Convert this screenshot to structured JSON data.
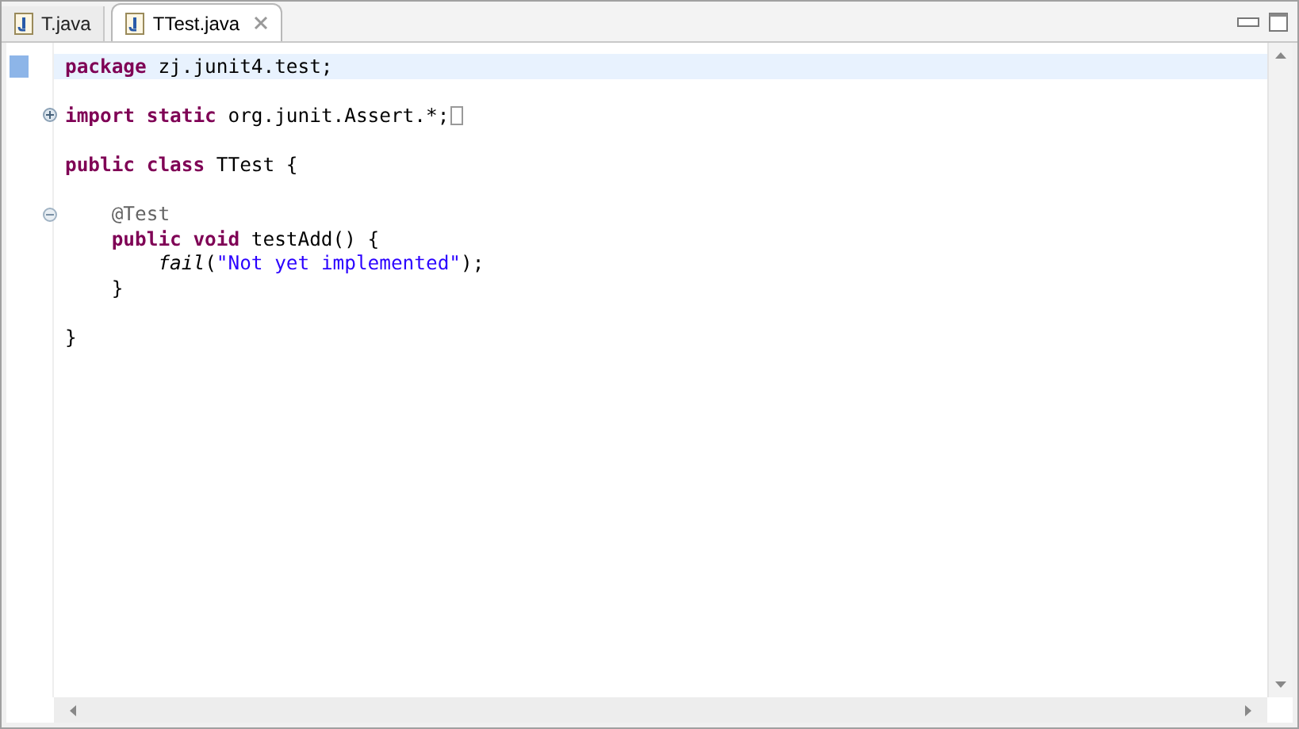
{
  "tabs": [
    {
      "label": "T.java",
      "selected": false
    },
    {
      "label": "TTest.java",
      "selected": true
    }
  ],
  "editor": {
    "lines": [
      {
        "kind": "code",
        "current": true,
        "tokens": [
          {
            "kind": "keyword",
            "text": "package "
          },
          {
            "kind": "plain",
            "text": "zj.junit4.test;"
          }
        ]
      },
      {
        "kind": "blank"
      },
      {
        "kind": "code",
        "current": false,
        "collapsed": true,
        "tokens": [
          {
            "kind": "keyword",
            "text": "import "
          },
          {
            "kind": "keyword",
            "text": "static "
          },
          {
            "kind": "plain",
            "text": "org.junit.Assert.*;"
          }
        ]
      },
      {
        "kind": "blank"
      },
      {
        "kind": "code",
        "current": false,
        "tokens": [
          {
            "kind": "keyword",
            "text": "public "
          },
          {
            "kind": "keyword",
            "text": "class "
          },
          {
            "kind": "plain",
            "text": "TTest {"
          }
        ]
      },
      {
        "kind": "blank"
      },
      {
        "kind": "code",
        "current": false,
        "collapsed": false,
        "tokens": [
          {
            "kind": "annotation",
            "text": "    @Test"
          }
        ]
      },
      {
        "kind": "code",
        "current": false,
        "tokens": [
          {
            "kind": "keyword",
            "text": "    public "
          },
          {
            "kind": "keyword",
            "text": "void "
          },
          {
            "kind": "plain",
            "text": "testAdd() {"
          }
        ]
      },
      {
        "kind": "code",
        "current": false,
        "tokens": [
          {
            "kind": "static_call",
            "text": "        fail"
          },
          {
            "kind": "plain",
            "text": "("
          },
          {
            "kind": "string",
            "text": "\"Not yet implemented\""
          },
          {
            "kind": "plain",
            "text": ");"
          }
        ]
      },
      {
        "kind": "code",
        "current": false,
        "tokens": [
          {
            "kind": "plain",
            "text": "    }"
          }
        ]
      },
      {
        "kind": "blank"
      },
      {
        "kind": "code",
        "current": false,
        "tokens": [
          {
            "kind": "plain",
            "text": "}"
          }
        ]
      }
    ]
  }
}
